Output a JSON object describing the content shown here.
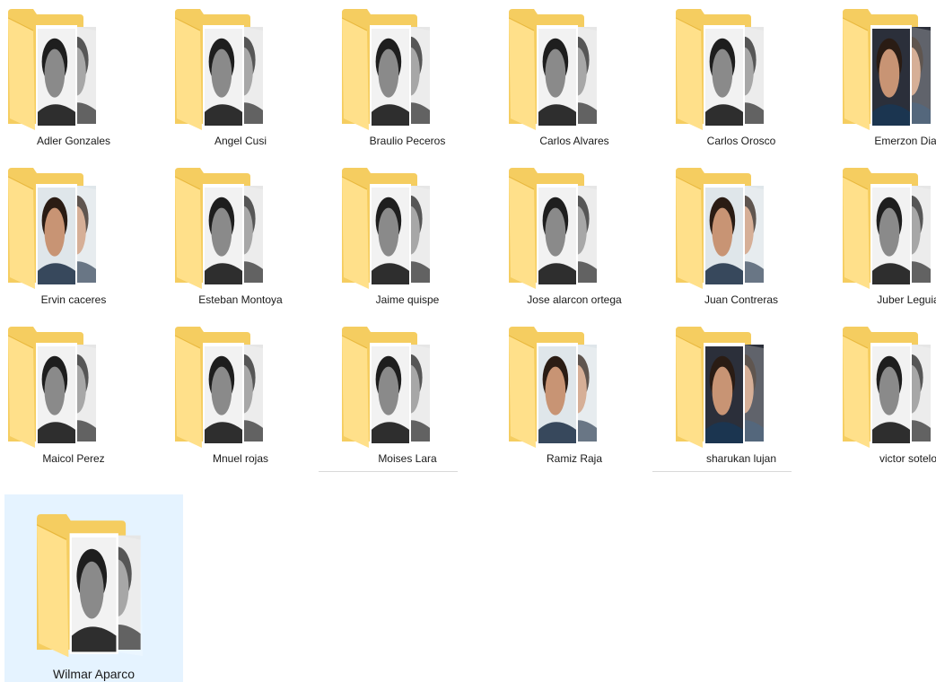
{
  "folders": [
    {
      "name": "Adler Gonzales",
      "thumb": "bw"
    },
    {
      "name": "Angel Cusi",
      "thumb": "bw"
    },
    {
      "name": "Braulio Peceros",
      "thumb": "bw"
    },
    {
      "name": "Carlos Alvares",
      "thumb": "bw"
    },
    {
      "name": "Carlos Orosco",
      "thumb": "bw"
    },
    {
      "name": "Emerzon Dias",
      "thumb": "color-dark"
    },
    {
      "name": "Ervin caceres",
      "thumb": "color"
    },
    {
      "name": "Esteban Montoya",
      "thumb": "bw"
    },
    {
      "name": "Jaime quispe",
      "thumb": "bw"
    },
    {
      "name": "Jose alarcon ortega",
      "thumb": "bw"
    },
    {
      "name": "Juan Contreras",
      "thumb": "color"
    },
    {
      "name": "Juber Leguia",
      "thumb": "bw"
    },
    {
      "name": "Maicol Perez",
      "thumb": "bw"
    },
    {
      "name": "Mnuel rojas",
      "thumb": "bw"
    },
    {
      "name": "Moises Lara",
      "thumb": "bw"
    },
    {
      "name": "Ramiz Raja",
      "thumb": "color"
    },
    {
      "name": "sharukan lujan",
      "thumb": "color-dark"
    },
    {
      "name": "victor sotelo",
      "thumb": "bw"
    },
    {
      "name": "Wilmar Aparco",
      "thumb": "bw"
    }
  ],
  "selected_index": 18,
  "colors": {
    "folder_back": "#f5cd60",
    "folder_front": "#ffe08a",
    "folder_edge": "#e8b73c",
    "selection": "#e5f3ff",
    "label": "#1a1a1a"
  }
}
